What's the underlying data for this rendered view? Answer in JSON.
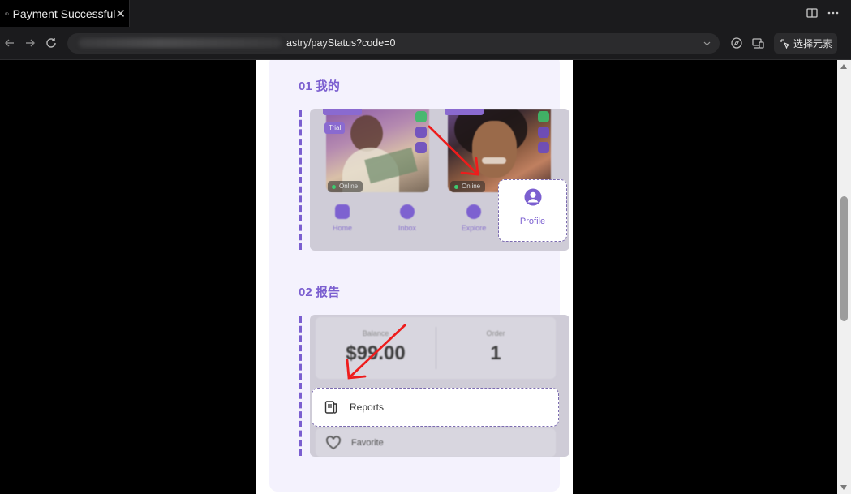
{
  "browser": {
    "tab_title": "Payment Successful",
    "tab_close": "✕",
    "url": "astry/payStatus?code=0",
    "select_element_label": "选择元素"
  },
  "page": {
    "section1": {
      "title": "01 我的"
    },
    "section2": {
      "title": "02 报告"
    },
    "profile_label": "Profile",
    "nav_items": [
      "Home",
      "Inbox",
      "Explore"
    ],
    "online_badge": "Online",
    "trial_badge": "Trial",
    "stats": {
      "balance_label": "Balance",
      "balance_value": "$99.00",
      "order_label": "Order",
      "order_value": "1"
    },
    "reports_label": "Reports",
    "favorite_label": "Favorite"
  },
  "colors": {
    "accent": "#7b5fd0",
    "arrow": "#ee1c1c"
  }
}
